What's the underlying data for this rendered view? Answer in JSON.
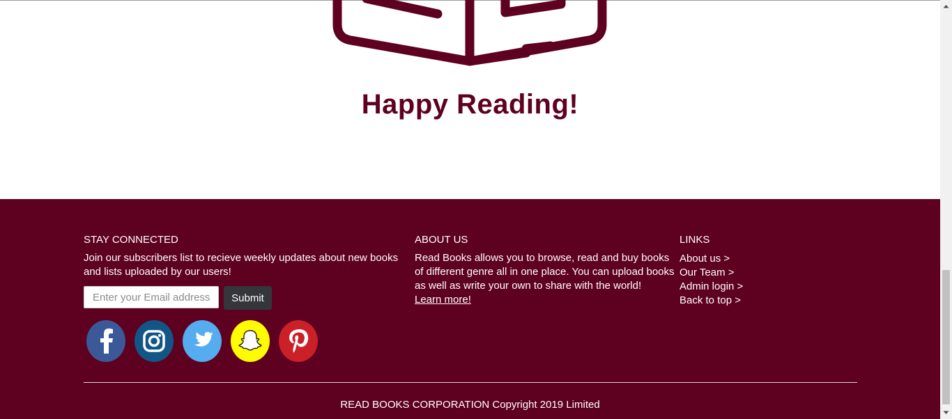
{
  "hero": {
    "title": "Happy Reading!"
  },
  "footer": {
    "stay_connected": {
      "title": "STAY CONNECTED",
      "line1": "Join our subscribers list to recieve weekly updates about new books",
      "line2": "and lists uploaded by our users!",
      "email_placeholder": "Enter your Email address",
      "email_value": "",
      "submit_label": "Submit"
    },
    "social": [
      {
        "name": "facebook-icon",
        "color": "#3b5998"
      },
      {
        "name": "instagram-icon",
        "color": "#125688"
      },
      {
        "name": "twitter-icon",
        "color": "#55acee"
      },
      {
        "name": "snapchat-icon",
        "color": "#fffc00"
      },
      {
        "name": "pinterest-icon",
        "color": "#cb2027"
      }
    ],
    "about": {
      "title": "ABOUT US",
      "line1": "Read Books allows you to browse, read and buy books",
      "line2": "of different genre all in one place. You can upload books",
      "line3": "as well as write your own to share with the world!",
      "learn_more": "Learn more!"
    },
    "links": {
      "title": "LINKS",
      "items": [
        "About us >",
        "Our Team >",
        "Admin login >",
        "Back to top >"
      ]
    },
    "copyright": "READ BOOKS CORPORATION Copyright 2019 Limited"
  },
  "colors": {
    "brand": "#5e0020"
  }
}
